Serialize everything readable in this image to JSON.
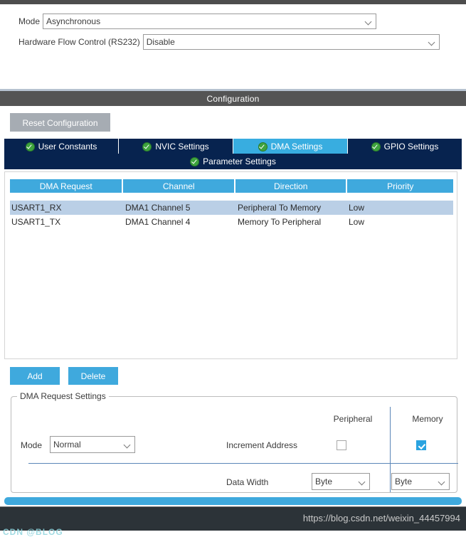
{
  "param_form": {
    "rows": [
      {
        "label": "Mode",
        "value": "Asynchronous"
      },
      {
        "label": "Hardware Flow Control (RS232)",
        "value": "Disable"
      }
    ]
  },
  "config": {
    "title": "Configuration",
    "reset_label": "Reset Configuration"
  },
  "tabs": {
    "row1": [
      {
        "label": "User Constants",
        "active": false
      },
      {
        "label": "NVIC Settings",
        "active": false
      },
      {
        "label": "DMA Settings",
        "active": true
      },
      {
        "label": "GPIO Settings",
        "active": false
      }
    ],
    "row2": [
      {
        "label": "Parameter Settings",
        "active": false
      }
    ]
  },
  "dma_table": {
    "columns": [
      "DMA Request",
      "Channel",
      "Direction",
      "Priority"
    ],
    "rows": [
      {
        "selected": true,
        "cells": [
          "USART1_RX",
          "DMA1 Channel 5",
          "Peripheral To Memory",
          "Low"
        ]
      },
      {
        "selected": false,
        "cells": [
          "USART1_TX",
          "DMA1 Channel 4",
          "Memory To Peripheral",
          "Low"
        ]
      }
    ]
  },
  "actions": {
    "add_label": "Add",
    "delete_label": "Delete"
  },
  "request_settings": {
    "group_title": "DMA Request Settings",
    "col_peripheral": "Peripheral",
    "col_memory": "Memory",
    "mode_label": "Mode",
    "mode_value": "Normal",
    "increment_label": "Increment Address",
    "increment_peripheral_checked": false,
    "increment_memory_checked": true,
    "data_width_label": "Data Width",
    "data_width_peripheral": "Byte",
    "data_width_memory": "Byte"
  },
  "footer": {
    "watermark": "https://blog.csdn.net/weixin_44457994",
    "cut_text": "CDN @BLOG"
  },
  "colors": {
    "accent_blue": "#3fa9dd",
    "tab_navy": "#07234f",
    "title_gray": "#545454",
    "row_selected": "#bacfe6"
  }
}
